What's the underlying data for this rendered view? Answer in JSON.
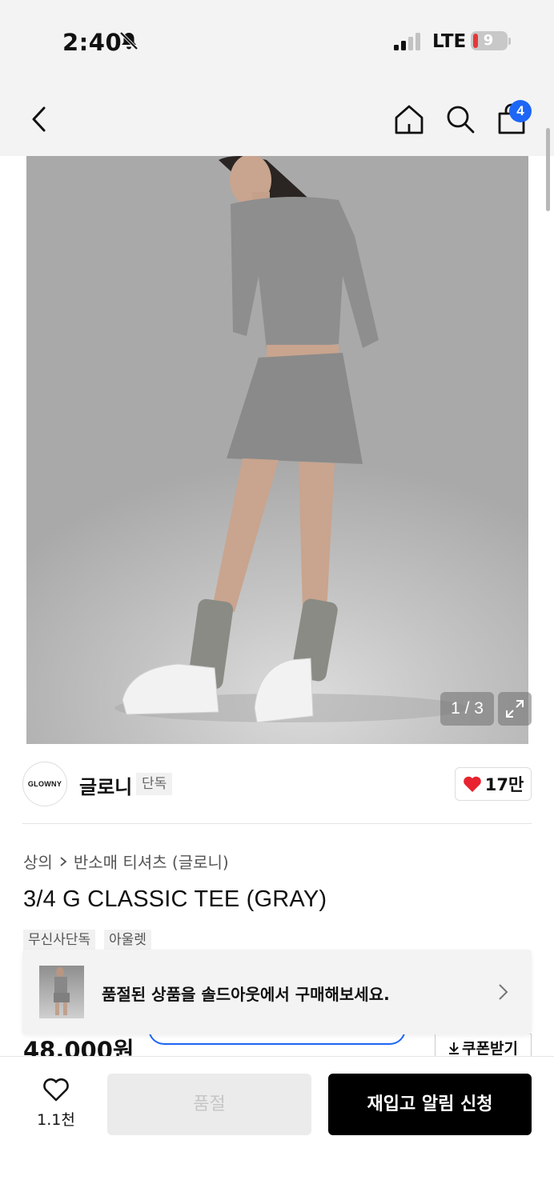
{
  "status_bar": {
    "time": "2:40",
    "network": "LTE",
    "battery": "9"
  },
  "header": {
    "cart_count": "4"
  },
  "gallery": {
    "counter": "1 / 3"
  },
  "brand": {
    "logo_text": "GLOWNY",
    "name": "글로니",
    "badge": "단독",
    "likes": "17만"
  },
  "breadcrumb": {
    "category": "상의",
    "subcategory": "반소매 티셔츠 (글로니)"
  },
  "product": {
    "title": "3/4 G CLASSIC TEE (GRAY)",
    "tags": [
      "무신사단독",
      "아울렛"
    ],
    "price": "48,000원"
  },
  "soldout_banner": {
    "text": "품절된 상품을 솔드아웃에서 구매해보세요."
  },
  "coupon": {
    "label": "쿠폰받기"
  },
  "bottom_bar": {
    "wish_count": "1.1천",
    "soldout_label": "품절",
    "restock_label": "재입고 알림 신청"
  },
  "colors": {
    "accent_blue": "#1e66f5",
    "heart_red": "#e8222f",
    "cta_black": "#000000"
  }
}
